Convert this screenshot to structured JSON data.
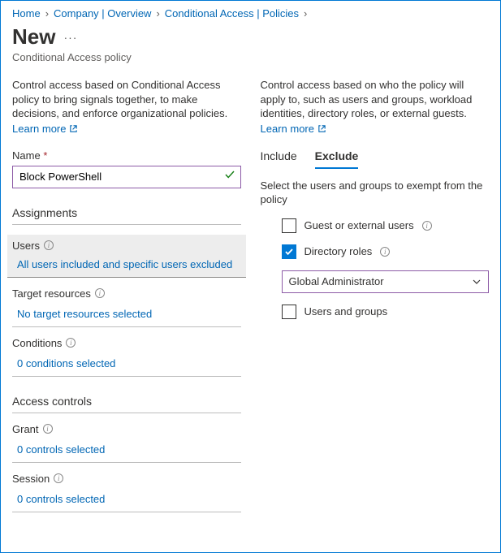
{
  "breadcrumb": {
    "home": "Home",
    "company": "Company | Overview",
    "policies": "Conditional Access | Policies"
  },
  "header": {
    "title": "New",
    "subtitle": "Conditional Access policy"
  },
  "left": {
    "desc": "Control access based on Conditional Access policy to bring signals together, to make decisions, and enforce organizational policies.",
    "learn": "Learn more",
    "name_label": "Name",
    "name_value": "Block PowerShell",
    "assignments": "Assignments",
    "users_label": "Users",
    "users_value": "All users included and specific users excluded",
    "target_label": "Target resources",
    "target_value": "No target resources selected",
    "conditions_label": "Conditions",
    "conditions_value": "0 conditions selected",
    "access_controls": "Access controls",
    "grant_label": "Grant",
    "grant_value": "0 controls selected",
    "session_label": "Session",
    "session_value": "0 controls selected"
  },
  "right": {
    "desc": "Control access based on who the policy will apply to, such as users and groups, workload identities, directory roles, or external guests.",
    "learn": "Learn more",
    "tab_include": "Include",
    "tab_exclude": "Exclude",
    "hint": "Select the users and groups to exempt from the policy",
    "opt_guest": "Guest or external users",
    "opt_roles": "Directory roles",
    "opt_groups": "Users and groups",
    "role_selected": "Global Administrator"
  }
}
